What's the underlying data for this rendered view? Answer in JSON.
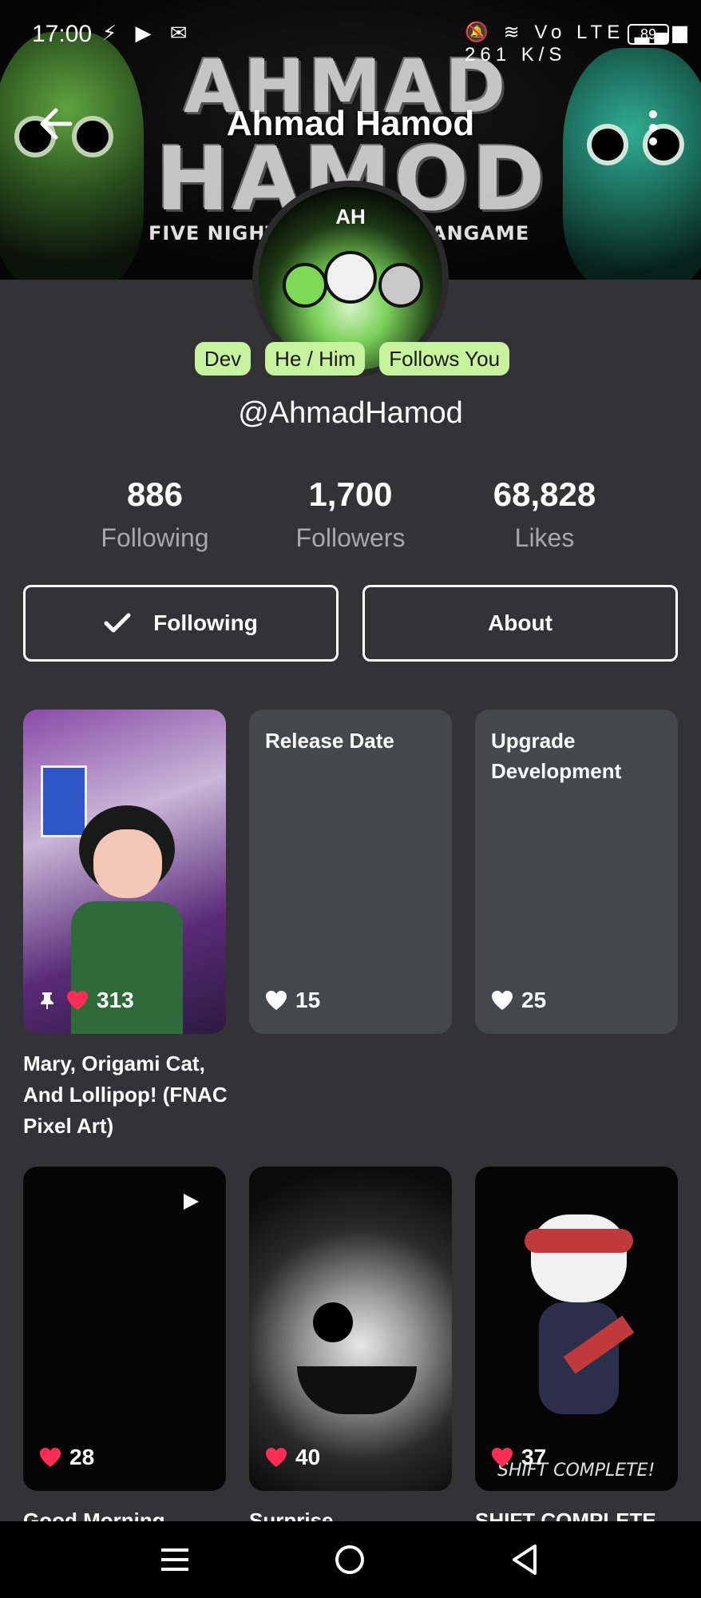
{
  "status_bar": {
    "time": "17:00",
    "left_icons": "⚡ ▶ ✉",
    "right_icons": "🔕 ≋ Vo LTE ▂▄▆ 261 K/S",
    "network": "Vo LTE",
    "speed": "261 K/S",
    "battery": "89"
  },
  "banner": {
    "word1": "AHMAD",
    "word2": "HAMOD",
    "sub_left": "FIVE NIGHT",
    "sub_right": "ANGAME"
  },
  "header": {
    "title": "Ahmad Hamod",
    "back_icon": "back-arrow-icon",
    "more_icon": "more-vertical-icon"
  },
  "avatar": {
    "tag": "AH"
  },
  "tags": [
    "Dev",
    "He / Him",
    "Follows You"
  ],
  "handle": "@AhmadHamod",
  "stats": [
    {
      "value": "886",
      "label": "Following"
    },
    {
      "value": "1,700",
      "label": "Followers"
    },
    {
      "value": "68,828",
      "label": "Likes"
    }
  ],
  "buttons": {
    "following": "Following",
    "about": "About"
  },
  "cards": [
    {
      "title": "",
      "likes": "313",
      "pinned": true,
      "caption": "Mary, Origami Cat, And Lollipop! (FNAC Pixel Art)"
    },
    {
      "title": "Release Date",
      "likes": "15"
    },
    {
      "title": "Upgrade Development",
      "likes": "25"
    },
    {
      "title": "",
      "likes": "28",
      "caption": "Good Morning"
    },
    {
      "title": "",
      "likes": "40",
      "caption": "Surprise"
    },
    {
      "title": "",
      "likes": "37",
      "overlay": "SHIFT COMPLETE!",
      "caption": "SHIFT COMPLETE"
    }
  ],
  "colors": {
    "background": "#333335",
    "card": "#46474b",
    "tag": "#c7f29e",
    "heart": "#ff2d55"
  }
}
